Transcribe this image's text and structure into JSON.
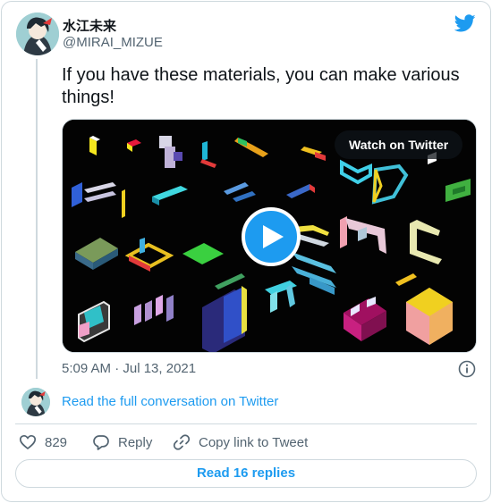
{
  "author": {
    "display_name": "水江未来",
    "handle": "@MIRAI_MIZUE"
  },
  "tweet": {
    "text": "If you have these materials, you can make various things!",
    "timestamp": "5:09 AM · Jul 13, 2021"
  },
  "media": {
    "watch_label": "Watch on Twitter"
  },
  "conversation": {
    "link_label": "Read the full conversation on Twitter"
  },
  "actions": {
    "like_count": "829",
    "reply_label": "Reply",
    "copy_label": "Copy link to Tweet"
  },
  "replies_button": "Read 16 replies",
  "colors": {
    "accent": "#1d9bf0",
    "secondary_text": "#536471",
    "border": "#cfd9de"
  },
  "icons": [
    "twitter-bird-icon",
    "play-icon",
    "info-icon",
    "heart-icon",
    "reply-icon",
    "link-icon"
  ]
}
